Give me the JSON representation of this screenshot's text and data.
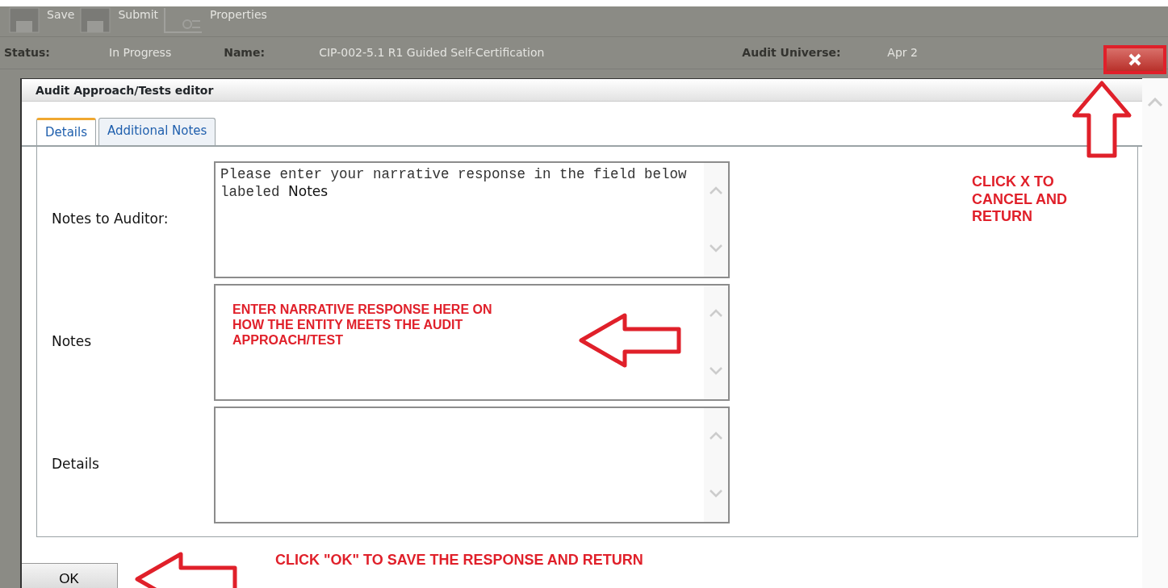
{
  "background": {
    "toolbar": [
      {
        "label": "Save"
      },
      {
        "label": "Submit"
      },
      {
        "label": "Properties"
      }
    ],
    "info": [
      {
        "label": "Status:",
        "value": "In Progress"
      },
      {
        "label": "Name:",
        "value": "CIP-002-5.1 R1 Guided Self-Certification"
      },
      {
        "label": "Audit Universe:",
        "value": "Apr 2"
      }
    ]
  },
  "dialog": {
    "title": "Audit Approach/Tests editor",
    "tabs": [
      {
        "label": "Details",
        "selected": true
      },
      {
        "label": "Additional Notes",
        "selected": false
      }
    ],
    "fields": [
      {
        "label": "Notes to Auditor:",
        "value": "Please enter your narrative response in the field below labeled",
        "value_tail": "Notes"
      },
      {
        "label": "Notes"
      },
      {
        "label": "Details"
      }
    ],
    "ok_button": "OK"
  },
  "annotations": [
    {
      "kind": "close",
      "text": "CLICK X  TO CANCEL AND RETURN"
    },
    {
      "kind": "notes",
      "text": "ENTER NARRATIVE RESPONSE HERE ON HOW THE ENTITY MEETS THE AUDIT APPROACH/TEST"
    },
    {
      "kind": "ok",
      "text": "CLICK \"OK\" TO SAVE THE RESPONSE AND RETURN"
    }
  ]
}
